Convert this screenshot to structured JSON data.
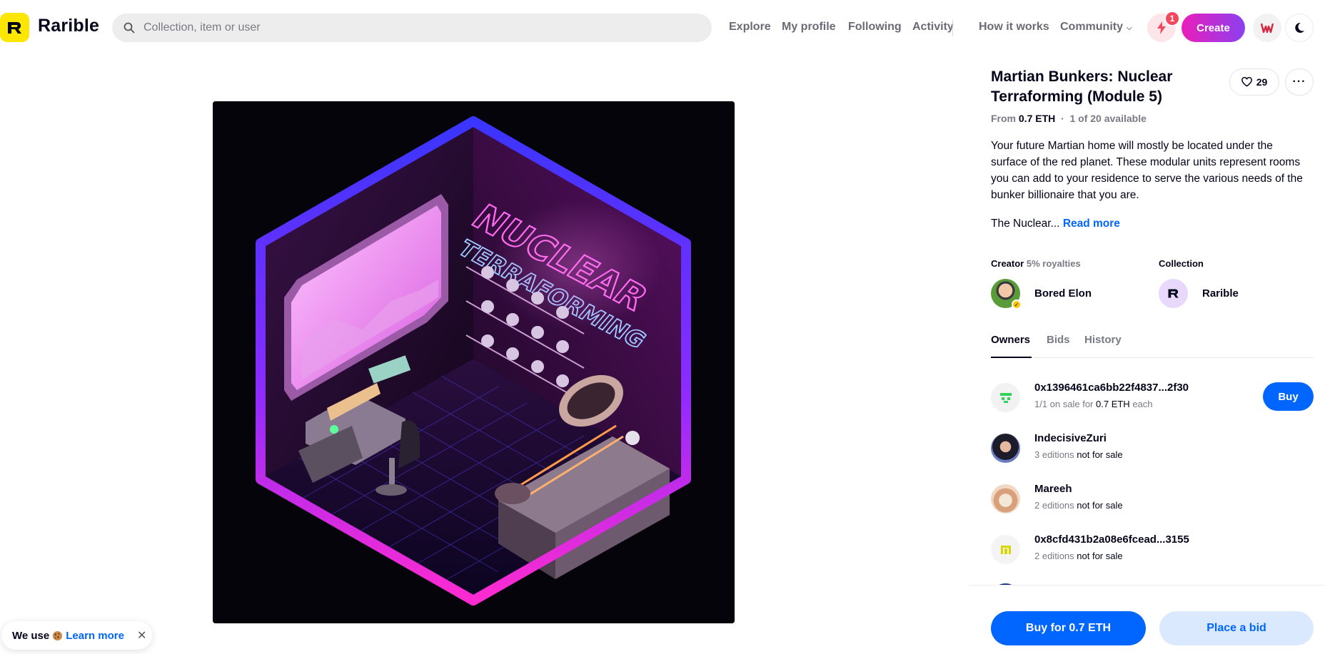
{
  "header": {
    "brand": "Rarible",
    "search_placeholder": "Collection, item or user",
    "nav": [
      "Explore",
      "My profile",
      "Following",
      "Activity",
      "How it works",
      "Community"
    ],
    "notification_count": "1",
    "create_label": "Create"
  },
  "item": {
    "title": "Martian Bunkers: Nuclear Terraforming (Module 5)",
    "likes": "29",
    "price_prefix": "From",
    "price": "0.7 ETH",
    "availability": "1 of 20 available",
    "description": "Your future Martian home will mostly be located under the surface of the red planet. These modular units represent rooms you can add to your residence to serve the various needs of the bunker billionaire that you are.",
    "description_more": "The Nuclear...",
    "read_more": "Read more",
    "image_text_1": "NUCLEAR",
    "image_text_2": "TERRAFORMING"
  },
  "creator": {
    "label": "Creator",
    "royalties": "5% royalties",
    "name": "Bored Elon"
  },
  "collection": {
    "label": "Collection",
    "name": "Rarible"
  },
  "tabs": [
    "Owners",
    "Bids",
    "History"
  ],
  "owners": [
    {
      "name": "0x1396461ca6bb22f4837...2f30",
      "sub_a": "1/1 on sale for",
      "sub_b": "0.7 ETH",
      "sub_c": "each"
    },
    {
      "name": "IndecisiveZuri",
      "sub_a": "3 editions",
      "sub_b": "not for sale",
      "sub_c": ""
    },
    {
      "name": "Mareeh",
      "sub_a": "2 editions",
      "sub_b": "not for sale",
      "sub_c": ""
    },
    {
      "name": "0x8cfd431b2a08e6fcead...3155",
      "sub_a": "2 editions",
      "sub_b": "not for sale",
      "sub_c": ""
    }
  ],
  "actions": {
    "buy_small": "Buy",
    "buy_big": "Buy for 0.7 ETH",
    "bid": "Place a bid"
  },
  "cookie": {
    "text": "We use",
    "learn": "Learn more"
  },
  "colors": {
    "accent_blue": "#0066ff",
    "brand_yellow": "#fee603",
    "create_gradient_start": "#ea1eb9",
    "create_gradient_end": "#8b40f0"
  }
}
